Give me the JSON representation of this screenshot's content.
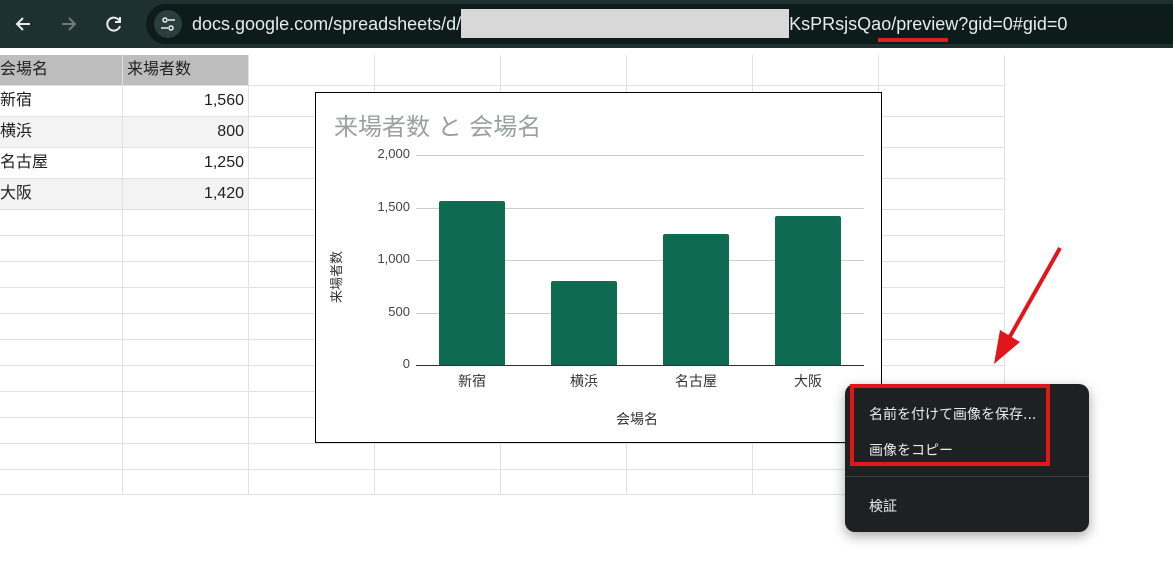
{
  "browser": {
    "url_prefix": "docs.google.com/spreadsheets/d/",
    "url_suffix": "KsPRsjsQao/",
    "url_highlight": "preview",
    "url_tail": "?gid=0#gid=0"
  },
  "sheet": {
    "headers": [
      "会場名",
      "来場者数"
    ],
    "rows": [
      {
        "venue": "新宿",
        "count": "1,560"
      },
      {
        "venue": "横浜",
        "count": "800"
      },
      {
        "venue": "名古屋",
        "count": "1,250"
      },
      {
        "venue": "大阪",
        "count": "1,420"
      }
    ]
  },
  "chart_data": {
    "type": "bar",
    "title": "来場者数 と 会場名",
    "xlabel": "会場名",
    "ylabel": "来場者数",
    "categories": [
      "新宿",
      "横浜",
      "名古屋",
      "大阪"
    ],
    "values": [
      1560,
      800,
      1250,
      1420
    ],
    "ylim": [
      0,
      2000
    ],
    "yticks": [
      "0",
      "500",
      "1,000",
      "1,500",
      "2,000"
    ],
    "bar_color": "#0e6a51",
    "grid": true,
    "legend": "none"
  },
  "context_menu": {
    "items": [
      "名前を付けて画像を保存...",
      "画像をコピー",
      "検証"
    ]
  },
  "colors": {
    "annotation": "#e0161a",
    "toolbar": "#1e3030"
  }
}
